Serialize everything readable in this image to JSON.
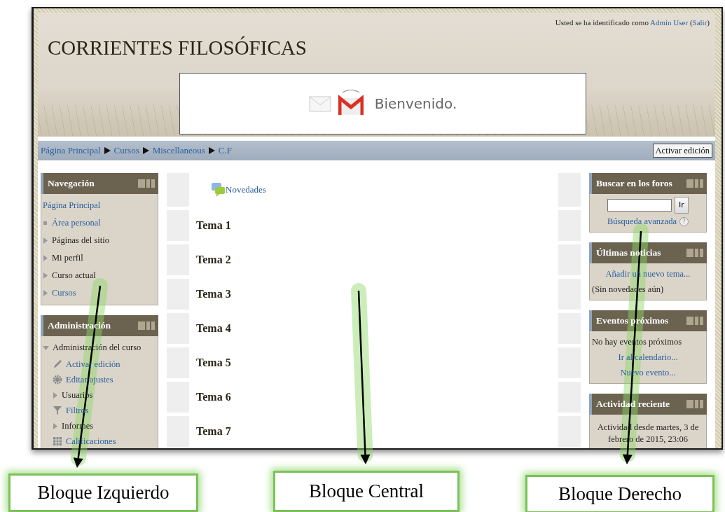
{
  "header": {
    "login_text": "Usted se ha identificado como",
    "user_link": "Admin User",
    "paren_open": "(",
    "logout_link": "Salir",
    "paren_close": ")",
    "site_title": "CORRIENTES FILOSÓFICAS",
    "banner_text": "Bienvenido."
  },
  "breadcrumb": [
    "Página Principal",
    "Cursos",
    "Miscellaneous",
    "C.F"
  ],
  "edit_button": "Activar edición",
  "left_blocks": [
    {
      "title": "Navegación",
      "items": [
        {
          "kind": "plain",
          "label": "Página Principal",
          "link": true
        },
        {
          "kind": "bullet",
          "label": "Área personal",
          "link": true
        },
        {
          "kind": "branch",
          "label": "Páginas del sitio",
          "link": false,
          "expanded": false
        },
        {
          "kind": "branch",
          "label": "Mi perfil",
          "link": false,
          "expanded": false
        },
        {
          "kind": "branch",
          "label": "Curso actual",
          "link": false,
          "expanded": false
        },
        {
          "kind": "branch",
          "label": "Cursos",
          "link": true,
          "expanded": false
        }
      ]
    },
    {
      "title": "Administración",
      "items": [
        {
          "kind": "branch",
          "label": "Administración del curso",
          "link": false,
          "expanded": true,
          "children": [
            {
              "kind": "pencil",
              "label": "Activar edición",
              "link": true
            },
            {
              "kind": "gear",
              "label": "Editar ajustes",
              "link": true
            },
            {
              "kind": "branch",
              "label": "Usuarios",
              "link": false,
              "expanded": false
            },
            {
              "kind": "funnel",
              "label": "Filtros",
              "link": true
            },
            {
              "kind": "branch",
              "label": "Informes",
              "link": false,
              "expanded": false
            },
            {
              "kind": "grid",
              "label": "Calificaciones",
              "link": true
            }
          ]
        }
      ]
    }
  ],
  "sections": [
    {
      "kind": "forum",
      "label": "Novedades"
    },
    {
      "kind": "topic",
      "label": "Tema 1"
    },
    {
      "kind": "topic",
      "label": "Tema 2"
    },
    {
      "kind": "topic",
      "label": "Tema 3"
    },
    {
      "kind": "topic",
      "label": "Tema 4"
    },
    {
      "kind": "topic",
      "label": "Tema 5"
    },
    {
      "kind": "topic",
      "label": "Tema 6"
    },
    {
      "kind": "topic",
      "label": "Tema 7"
    }
  ],
  "right_blocks": [
    {
      "title": "Buscar en los foros",
      "lines": [
        {
          "kind": "search",
          "button": "Ir"
        },
        {
          "kind": "help-link",
          "text": "Búsqueda avanzada",
          "help": "?"
        }
      ]
    },
    {
      "title": "Últimas noticias",
      "lines": [
        {
          "kind": "link",
          "text": "Añadir un nuevo tema..."
        },
        {
          "kind": "text",
          "text": "(Sin novedades aún)"
        }
      ]
    },
    {
      "title": "Eventos próximos",
      "lines": [
        {
          "kind": "text",
          "text": "No hay eventos próximos"
        },
        {
          "kind": "link",
          "text": "Ir al calendario..."
        },
        {
          "kind": "link",
          "text": "Nuevo evento..."
        }
      ]
    },
    {
      "title": "Actividad reciente",
      "lines": [
        {
          "kind": "note",
          "text": "Actividad desde martes, 3 de febrero de 2015, 23:06"
        }
      ]
    }
  ],
  "annotations": [
    {
      "label": "Bloque Izquierdo"
    },
    {
      "label": "Bloque Central"
    },
    {
      "label": "Bloque Derecho"
    }
  ]
}
